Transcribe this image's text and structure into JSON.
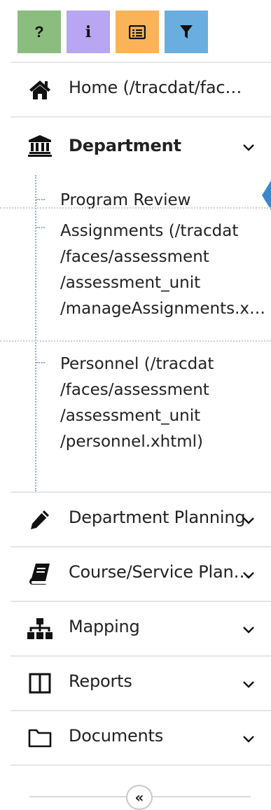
{
  "toolbar": {
    "help": {
      "glyph": "?",
      "color": "#8bbd7f",
      "icon": "question-icon"
    },
    "info": {
      "glyph": "i",
      "color": "#b9a6f2",
      "icon": "info-icon"
    },
    "list": {
      "color": "#fbb35a",
      "icon": "list-icon"
    },
    "filter": {
      "color": "#6aaee0",
      "icon": "filter-icon"
    }
  },
  "nav": {
    "home": {
      "label": "Home (/tracdat/fac…",
      "icon": "home-icon"
    },
    "department": {
      "label": "Department",
      "icon": "institution-icon"
    },
    "department_children": [
      {
        "label": "Program Review"
      },
      {
        "label": "Assignments (/tracdat\n/faces/assessment\n/assessment_unit\n/manageAssignments.x…"
      },
      {
        "label": "Personnel (/tracdat\n/faces/assessment\n/assessment_unit\n/personnel.xhtml)"
      }
    ],
    "department_planning": {
      "label": "Department Planning",
      "icon": "pencil-icon"
    },
    "course_service": {
      "label": "Course/Service Plan…",
      "icon": "book-icon"
    },
    "mapping": {
      "label": "Mapping",
      "icon": "sitemap-icon"
    },
    "reports": {
      "label": "Reports",
      "icon": "columns-icon"
    },
    "documents": {
      "label": "Documents",
      "icon": "folder-icon"
    }
  },
  "collapse": {
    "glyph": "«",
    "icon": "double-left-icon"
  },
  "colors": {
    "accent": "#3b87c9",
    "dotted": "#7fb3d8"
  }
}
